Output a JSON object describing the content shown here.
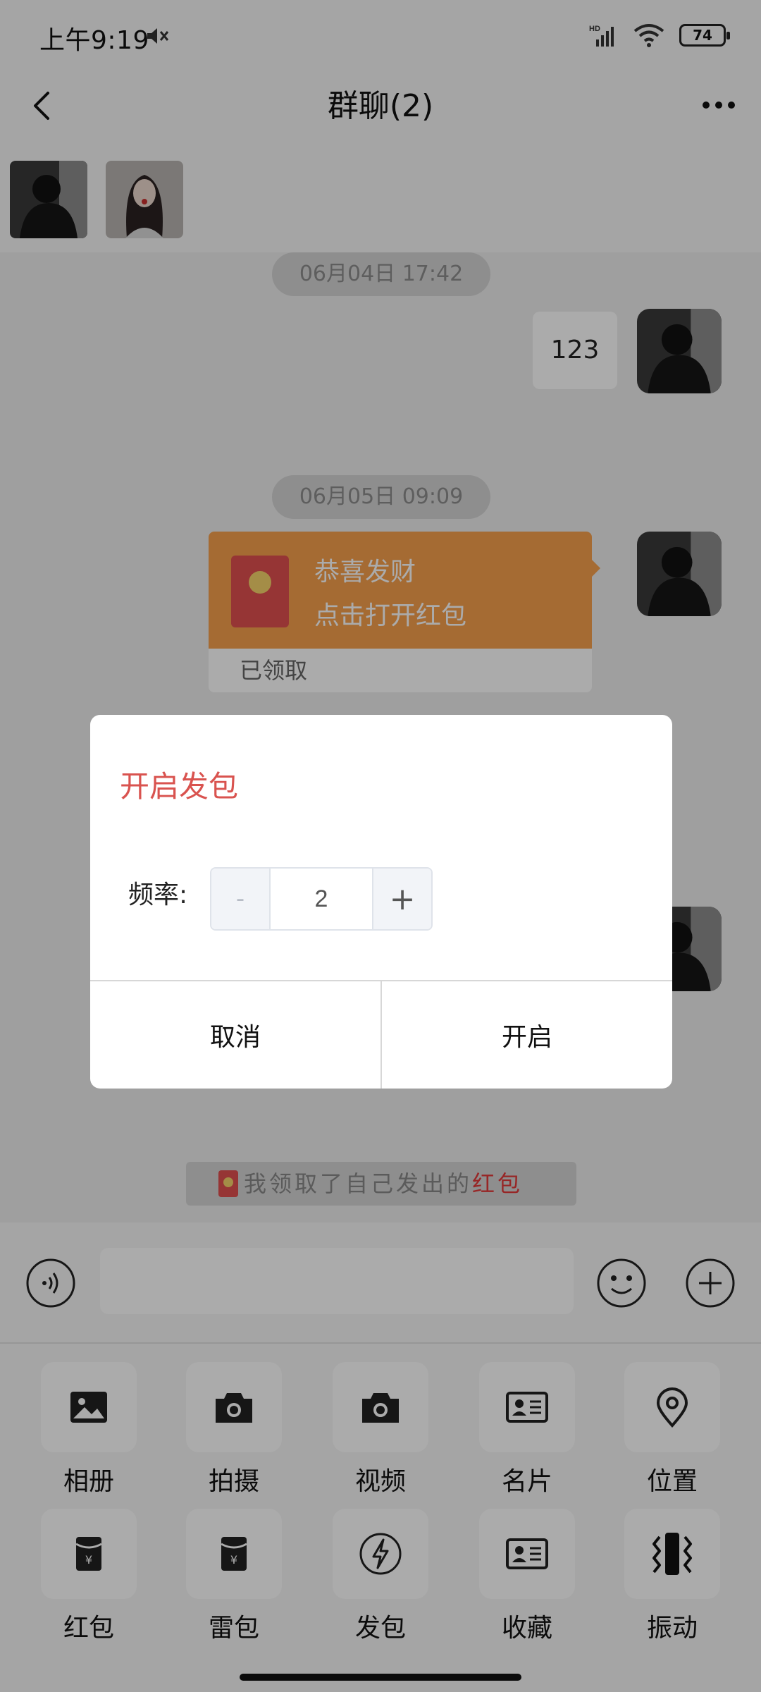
{
  "status_bar": {
    "time": "上午9:19",
    "battery": "74"
  },
  "header": {
    "title": "群聊(2)"
  },
  "chat": {
    "timestamps": [
      "06月04日 17:42",
      "06月05日 09:09"
    ],
    "message_text": "123",
    "red_packet": {
      "greeting": "恭喜发财",
      "action": "点击打开红包",
      "status": "已领取"
    },
    "system_notice": {
      "prefix": "我领取了自己发出的",
      "highlight": "红包"
    }
  },
  "input": {
    "placeholder": ""
  },
  "panel": {
    "tools": [
      {
        "label": "相册",
        "icon": "album-icon"
      },
      {
        "label": "拍摄",
        "icon": "camera-icon"
      },
      {
        "label": "视频",
        "icon": "video-icon"
      },
      {
        "label": "名片",
        "icon": "card-icon"
      },
      {
        "label": "位置",
        "icon": "location-icon"
      },
      {
        "label": "红包",
        "icon": "red-packet-icon"
      },
      {
        "label": "雷包",
        "icon": "mine-packet-icon"
      },
      {
        "label": "发包",
        "icon": "lightning-icon"
      },
      {
        "label": "收藏",
        "icon": "favorite-card-icon"
      },
      {
        "label": "振动",
        "icon": "vibrate-icon"
      }
    ]
  },
  "dialog": {
    "title": "开启发包",
    "frequency_label": "频率:",
    "stepper": {
      "minus": "-",
      "value": "2",
      "plus": "+"
    },
    "cancel": "取消",
    "confirm": "开启"
  },
  "colors": {
    "dialog_title": "#d9534f",
    "red_packet": "#f6a04d",
    "notice_highlight": "#e23a3a"
  }
}
